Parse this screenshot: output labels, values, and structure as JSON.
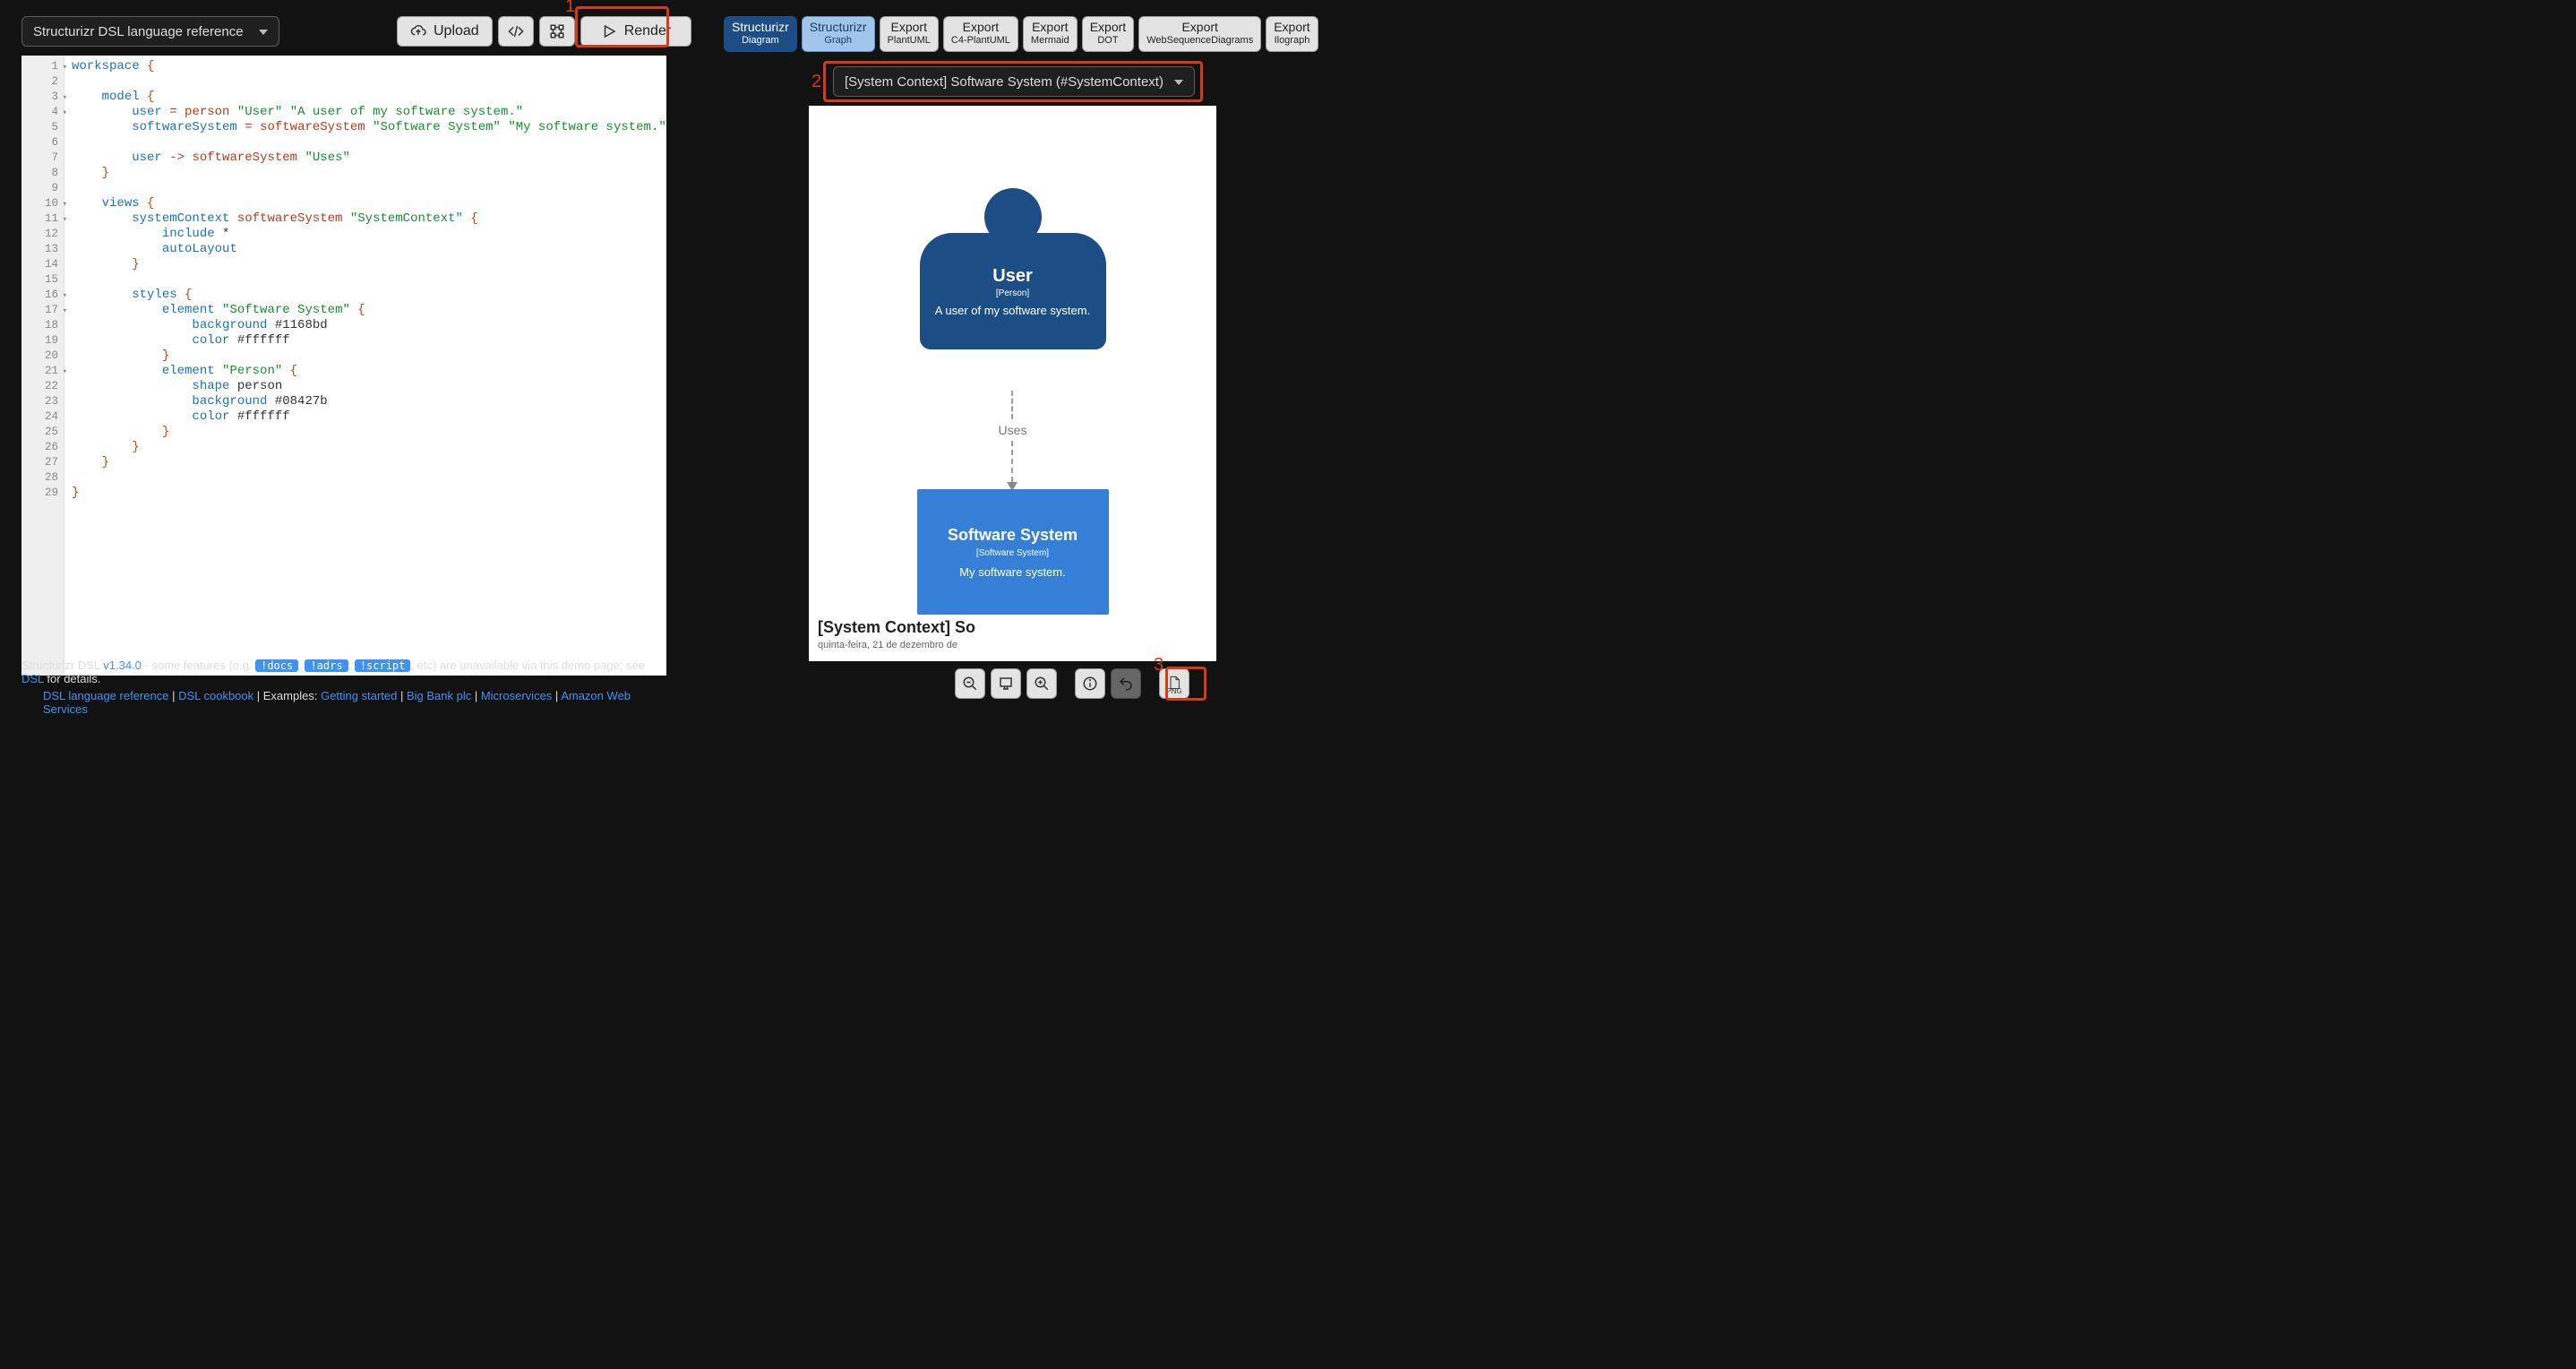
{
  "toolbar": {
    "reference_label": "Structurizr DSL language reference",
    "upload_label": "Upload",
    "render_label": "Render"
  },
  "editor": {
    "line_count": 29,
    "fold_lines": [
      1,
      3,
      4,
      10,
      11,
      16,
      17,
      21
    ]
  },
  "code_tokens": [
    [
      [
        "kw",
        "workspace"
      ],
      [
        "txt",
        " "
      ],
      [
        "brace",
        "{"
      ]
    ],
    [],
    [
      [
        "txt",
        "    "
      ],
      [
        "kw",
        "model"
      ],
      [
        "txt",
        " "
      ],
      [
        "brace",
        "{"
      ]
    ],
    [
      [
        "txt",
        "        "
      ],
      [
        "kw",
        "user"
      ],
      [
        "txt",
        " "
      ],
      [
        "op",
        "="
      ],
      [
        "txt",
        " "
      ],
      [
        "var",
        "person"
      ],
      [
        "txt",
        " "
      ],
      [
        "str",
        "\"User\""
      ],
      [
        "txt",
        " "
      ],
      [
        "str",
        "\"A user of my software system.\""
      ]
    ],
    [
      [
        "txt",
        "        "
      ],
      [
        "kw",
        "softwareSystem"
      ],
      [
        "txt",
        " "
      ],
      [
        "op",
        "="
      ],
      [
        "txt",
        " "
      ],
      [
        "var",
        "softwareSystem"
      ],
      [
        "txt",
        " "
      ],
      [
        "str",
        "\"Software System\""
      ],
      [
        "txt",
        " "
      ],
      [
        "str",
        "\"My software system.\""
      ]
    ],
    [],
    [
      [
        "txt",
        "        "
      ],
      [
        "kw",
        "user"
      ],
      [
        "txt",
        " "
      ],
      [
        "op",
        "->"
      ],
      [
        "txt",
        " "
      ],
      [
        "var",
        "softwareSystem"
      ],
      [
        "txt",
        " "
      ],
      [
        "str",
        "\"Uses\""
      ]
    ],
    [
      [
        "txt",
        "    "
      ],
      [
        "brace",
        "}"
      ]
    ],
    [],
    [
      [
        "txt",
        "    "
      ],
      [
        "kw",
        "views"
      ],
      [
        "txt",
        " "
      ],
      [
        "brace",
        "{"
      ]
    ],
    [
      [
        "txt",
        "        "
      ],
      [
        "kw",
        "systemContext"
      ],
      [
        "txt",
        " "
      ],
      [
        "var",
        "softwareSystem"
      ],
      [
        "txt",
        " "
      ],
      [
        "str",
        "\"SystemContext\""
      ],
      [
        "txt",
        " "
      ],
      [
        "brace",
        "{"
      ]
    ],
    [
      [
        "txt",
        "            "
      ],
      [
        "kw",
        "include"
      ],
      [
        "txt",
        " *"
      ]
    ],
    [
      [
        "txt",
        "            "
      ],
      [
        "kw",
        "autoLayout"
      ]
    ],
    [
      [
        "txt",
        "        "
      ],
      [
        "brace",
        "}"
      ]
    ],
    [],
    [
      [
        "txt",
        "        "
      ],
      [
        "kw",
        "styles"
      ],
      [
        "txt",
        " "
      ],
      [
        "brace",
        "{"
      ]
    ],
    [
      [
        "txt",
        "            "
      ],
      [
        "kw",
        "element"
      ],
      [
        "txt",
        " "
      ],
      [
        "str",
        "\"Software System\""
      ],
      [
        "txt",
        " "
      ],
      [
        "brace",
        "{"
      ]
    ],
    [
      [
        "txt",
        "                "
      ],
      [
        "kw",
        "background"
      ],
      [
        "txt",
        " #1168bd"
      ]
    ],
    [
      [
        "txt",
        "                "
      ],
      [
        "kw",
        "color"
      ],
      [
        "txt",
        " #ffffff"
      ]
    ],
    [
      [
        "txt",
        "            "
      ],
      [
        "brace",
        "}"
      ]
    ],
    [
      [
        "txt",
        "            "
      ],
      [
        "kw",
        "element"
      ],
      [
        "txt",
        " "
      ],
      [
        "str",
        "\"Person\""
      ],
      [
        "txt",
        " "
      ],
      [
        "brace",
        "{"
      ]
    ],
    [
      [
        "txt",
        "                "
      ],
      [
        "kw",
        "shape"
      ],
      [
        "txt",
        " person"
      ]
    ],
    [
      [
        "txt",
        "                "
      ],
      [
        "kw",
        "background"
      ],
      [
        "txt",
        " #08427b"
      ]
    ],
    [
      [
        "txt",
        "                "
      ],
      [
        "kw",
        "color"
      ],
      [
        "txt",
        " #ffffff"
      ]
    ],
    [
      [
        "txt",
        "            "
      ],
      [
        "brace",
        "}"
      ]
    ],
    [
      [
        "txt",
        "        "
      ],
      [
        "brace",
        "}"
      ]
    ],
    [
      [
        "txt",
        "    "
      ],
      [
        "brace",
        "}"
      ]
    ],
    [],
    [
      [
        "brace",
        "}"
      ]
    ]
  ],
  "footer": {
    "prefix": "Structurizr DSL ",
    "version": "v1.34.0",
    "mid1": " - some features (e.g. ",
    "b1": "!docs",
    "b2": "!adrs",
    "b3": "!script",
    "mid2": ", etc) are unavailable via this demo page; see ",
    "dsl": "DSL",
    "mid3": " for details.",
    "links": {
      "ref": "DSL language reference",
      "cookbook": "DSL cookbook",
      "examples_label": "Examples:",
      "getting_started": "Getting started",
      "bigbank": "Big Bank plc",
      "micro": "Microservices",
      "aws": "Amazon Web Services"
    }
  },
  "tabs": [
    {
      "t1": "Structurizr",
      "t2": "Diagram",
      "cls": "blue-dark"
    },
    {
      "t1": "Structurizr",
      "t2": "Graph",
      "cls": "blue-light"
    },
    {
      "t1": "Export",
      "t2": "PlantUML",
      "cls": ""
    },
    {
      "t1": "Export",
      "t2": "C4-PlantUML",
      "cls": ""
    },
    {
      "t1": "Export",
      "t2": "Mermaid",
      "cls": ""
    },
    {
      "t1": "Export",
      "t2": "DOT",
      "cls": ""
    },
    {
      "t1": "Export",
      "t2": "WebSequenceDiagrams",
      "cls": ""
    },
    {
      "t1": "Export",
      "t2": "Ilograph",
      "cls": ""
    }
  ],
  "view_select": "[System Context] Software System (#SystemContext)",
  "diagram": {
    "user_name": "User",
    "user_type": "[Person]",
    "user_desc": "A user of my software system.",
    "uses": "Uses",
    "sys_name": "Software System",
    "sys_type": "[Software System]",
    "sys_desc": "My software system.",
    "caption_title": "[System Context] So",
    "caption_date": "quinta-feira, 21 de dezembro de"
  },
  "png_label": "PNG"
}
